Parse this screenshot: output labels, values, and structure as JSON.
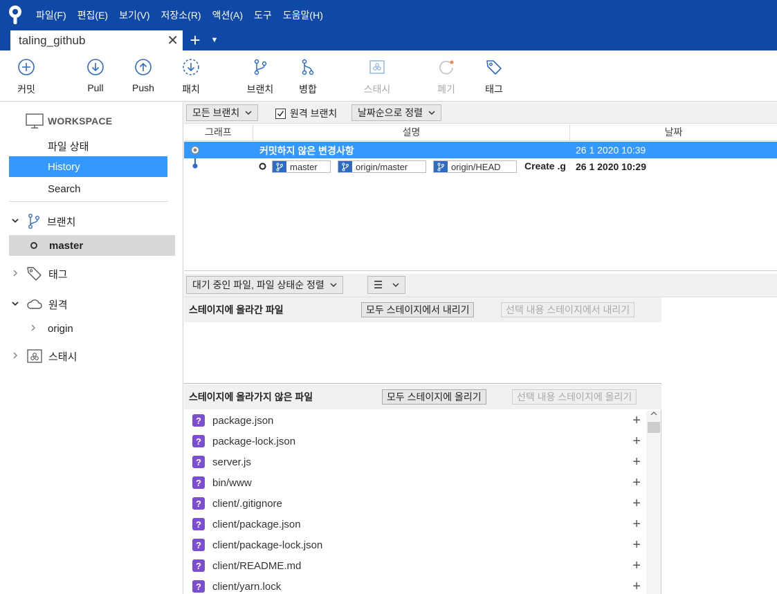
{
  "menu": {
    "items": [
      "파일(F)",
      "편집(E)",
      "보기(V)",
      "저장소(R)",
      "액션(A)",
      "도구",
      "도움말(H)"
    ]
  },
  "tabs": {
    "active_label": "taling_github",
    "close_glyph": "✕",
    "add_glyph": "+",
    "dropdown_glyph": "▼"
  },
  "toolbar": {
    "commit": "커밋",
    "pull": "Pull",
    "push": "Push",
    "patch": "패치",
    "branch": "브랜치",
    "merge": "병합",
    "stash": "스태시",
    "discard": "폐기",
    "tag": "태그"
  },
  "sidebar": {
    "workspace": "WORKSPACE",
    "file_status": "파일 상태",
    "history": "History",
    "search": "Search",
    "branches": "브랜치",
    "branch_master": "master",
    "tags": "태그",
    "remotes": "원격",
    "remote_origin": "origin",
    "stashes": "스태시"
  },
  "graph_toolbar": {
    "branch_filter": "모든 브랜치",
    "remote_branches": "원격 브랜치",
    "sort": "날짜순으로 정렬"
  },
  "commit_list": {
    "columns": {
      "graph": "그래프",
      "description": "설명",
      "date": "날짜"
    },
    "rows": [
      {
        "description": "커밋하지 않은 변경사항",
        "date": "26 1 2020 10:39"
      },
      {
        "refs": [
          "master",
          "origin/master",
          "origin/HEAD"
        ],
        "description": "Create .g",
        "date": "26 1 2020 10:29"
      }
    ]
  },
  "bottom_toolbar": {
    "sort": "대기 중인 파일, 파일 상태순 정렬",
    "view_glyph": "☰"
  },
  "staged": {
    "title": "스테이지에 올라간 파일",
    "unstage_all": "모두 스테이지에서 내리기",
    "unstage_selected": "선택 내용 스테이지에서 내리기"
  },
  "unstaged": {
    "title": "스테이지에 올라가지 않은 파일",
    "stage_all": "모두 스테이지에 올리기",
    "stage_selected": "선택 내용 스테이지에 올리기",
    "files": [
      "package.json",
      "package-lock.json",
      "server.js",
      "bin/www",
      "client/.gitignore",
      "client/package.json",
      "client/package-lock.json",
      "client/README.md",
      "client/yarn.lock"
    ],
    "status_glyph": "?",
    "stage_glyph": "+"
  },
  "colors": {
    "titlebar": "#1048a8",
    "selection": "#3399ff",
    "untracked": "#7b4fcf",
    "ref_icon": "#2e6bc6"
  }
}
